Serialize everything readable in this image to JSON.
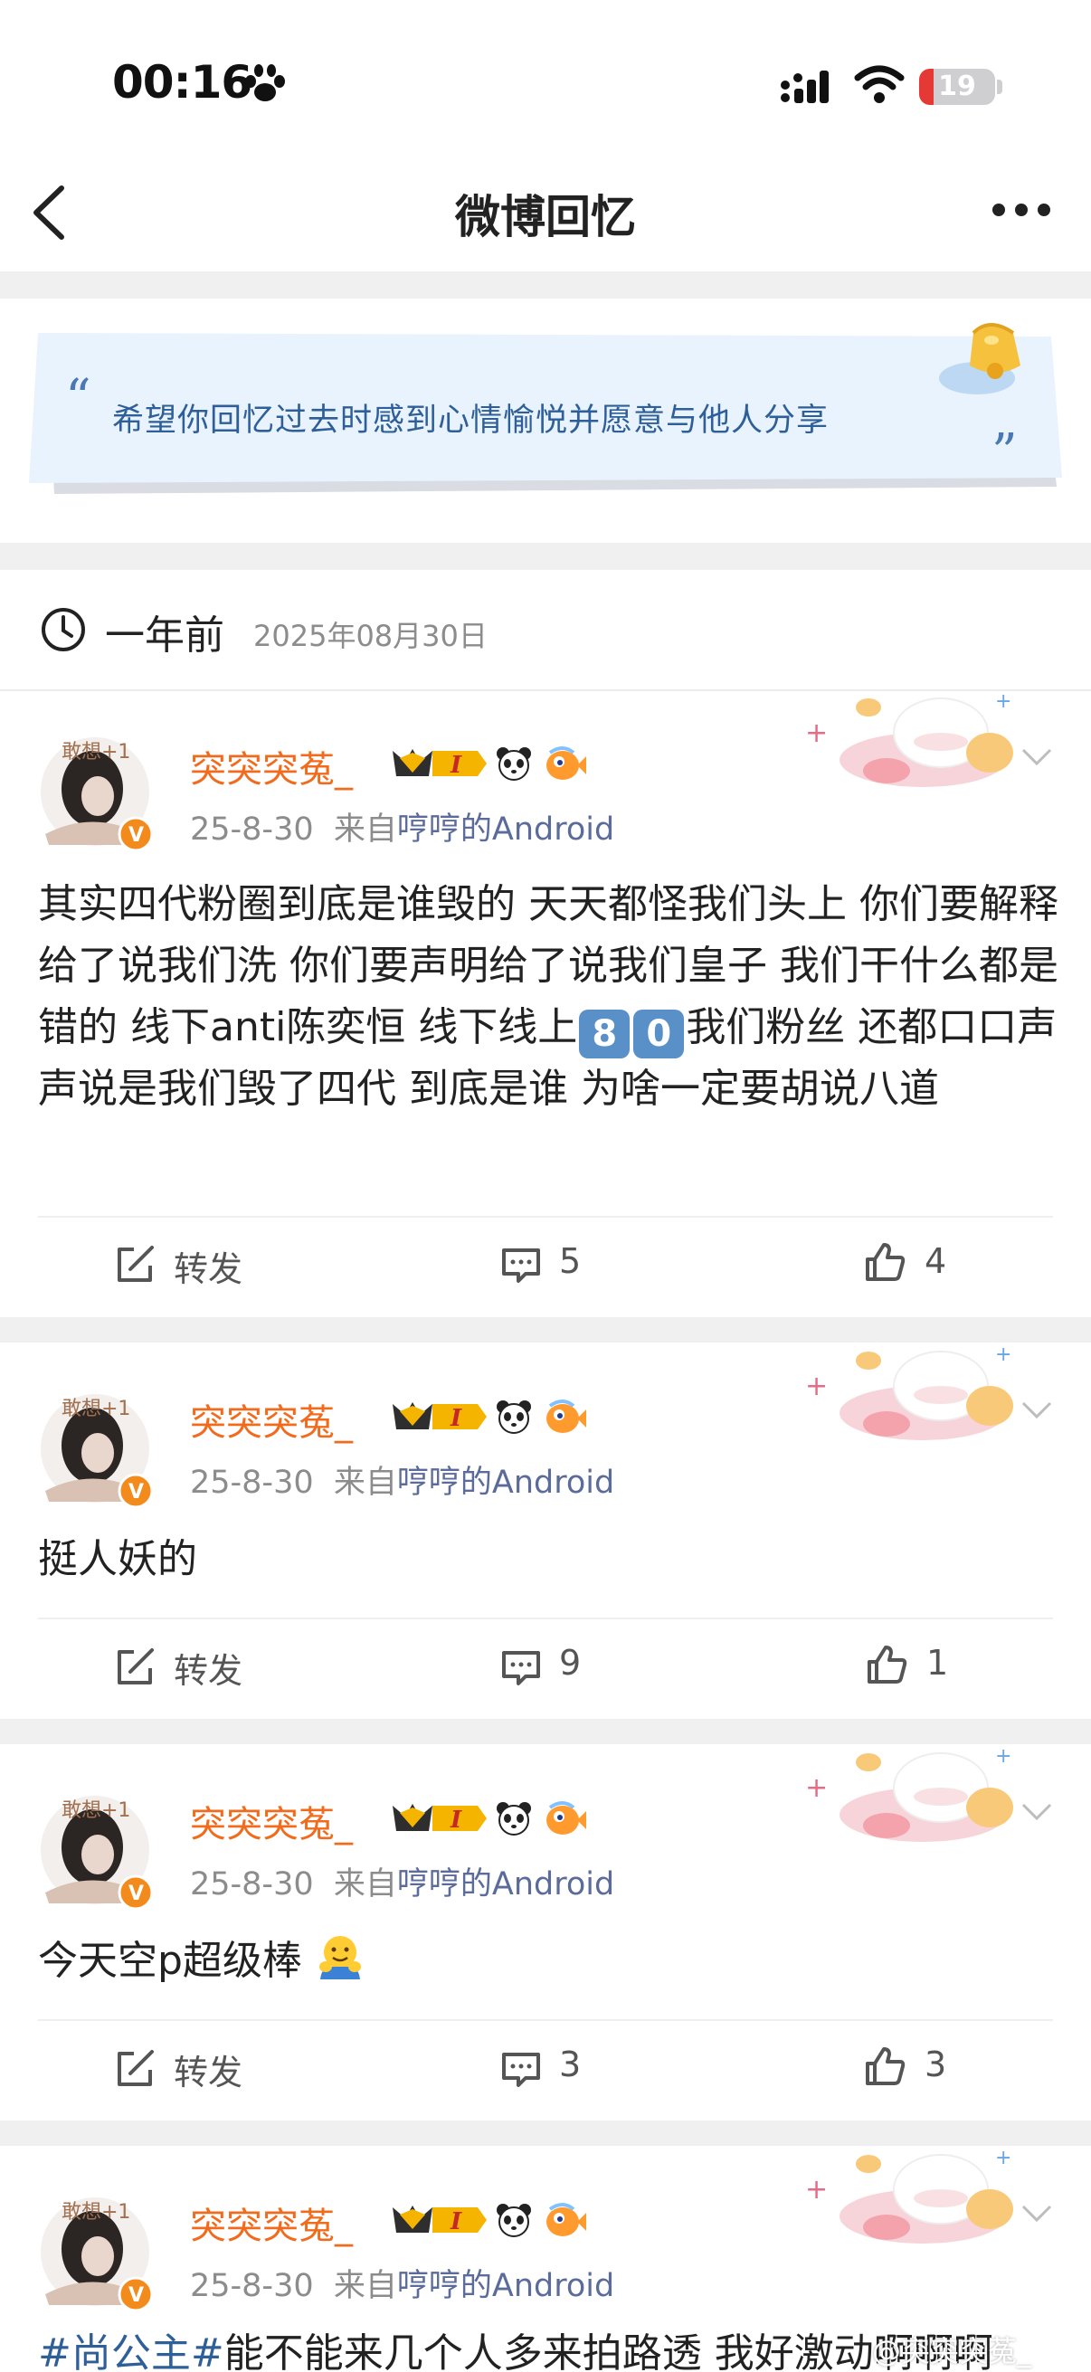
{
  "status_bar": {
    "time": "00:16",
    "battery": "19"
  },
  "nav": {
    "title": "微博回忆"
  },
  "banner": {
    "quote": "希望你回忆过去时感到心情愉悦并愿意与他人分享",
    "open_mark": "“",
    "close_mark": "”"
  },
  "date_header": {
    "ago": "一年前",
    "date": "2025年08月30日"
  },
  "posts": [
    {
      "author": "突突突菟_",
      "time": "25-8-30",
      "from": "来自",
      "source": "哼哼的Android",
      "text_a": "其实四代粉圈到底是谁毁的 天天都怪我们头上 你们要解释给了说我们洗 你们要声明给了说我们皇子 我们干什么都是错的 线下anti陈奕恒 线下线上",
      "key1": "8",
      "key2": "0",
      "text_b": "我们粉丝 还都口口声声说是我们毁了四代 到底是谁 为啥一定要胡说八道",
      "repost": "转发",
      "comments": "5",
      "likes": "4"
    },
    {
      "author": "突突突菟_",
      "time": "25-8-30",
      "from": "来自",
      "source": "哼哼的Android",
      "text": "挺人妖的",
      "repost": "转发",
      "comments": "9",
      "likes": "1"
    },
    {
      "author": "突突突菟_",
      "time": "25-8-30",
      "from": "来自",
      "source": "哼哼的Android",
      "text": "今天空p超级棒",
      "repost": "转发",
      "comments": "3",
      "likes": "3"
    },
    {
      "author": "突突突菟_",
      "time": "25-8-30",
      "from": "来自",
      "source": "哼哼的Android",
      "hashtag": "#尚公主#",
      "text": "能不能来几个人多来拍路透 我好激动啊啊啊"
    }
  ],
  "watermark": "@突突突菟_",
  "colors": {
    "author": "#f26b1d",
    "link": "#2f5f98",
    "divider": "#f0f0f0"
  }
}
